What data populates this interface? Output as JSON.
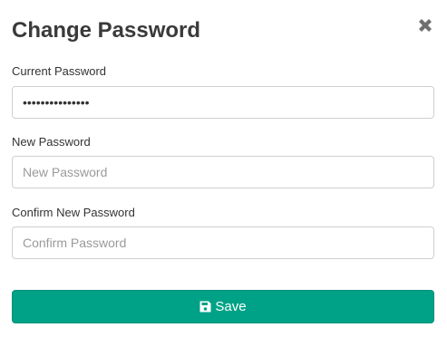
{
  "modal": {
    "title": "Change Password",
    "close_icon": "close-icon"
  },
  "fields": {
    "current": {
      "label": "Current Password",
      "value": "•••••••••••••••",
      "placeholder": ""
    },
    "new": {
      "label": "New Password",
      "value": "",
      "placeholder": "New Password"
    },
    "confirm": {
      "label": "Confirm New Password",
      "value": "",
      "placeholder": "Confirm Password"
    }
  },
  "save_button": {
    "label": "Save",
    "icon": "floppy-disk-icon",
    "color": "#00a287"
  }
}
